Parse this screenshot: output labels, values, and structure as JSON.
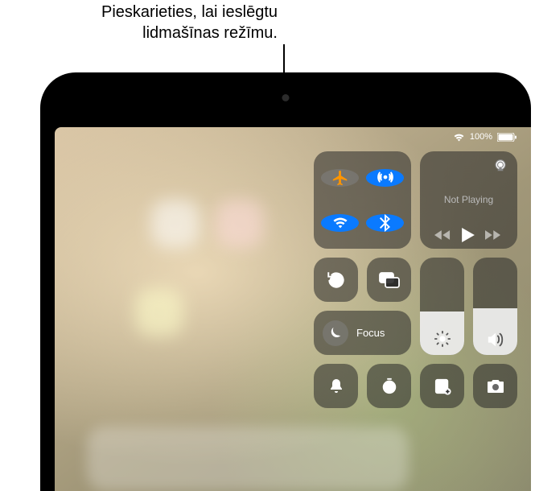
{
  "callout": {
    "line1": "Pieskarieties, lai ieslēgtu",
    "line2": "lidmašīnas režīmu."
  },
  "status": {
    "battery_pct": "100%"
  },
  "connectivity": {
    "airplane": {
      "on": false
    },
    "airdrop": {
      "on": true
    },
    "wifi": {
      "on": true
    },
    "bluetooth": {
      "on": true
    }
  },
  "media": {
    "label": "Not Playing"
  },
  "focus": {
    "label": "Focus"
  },
  "sliders": {
    "brightness_pct": 45,
    "volume_pct": 48
  }
}
